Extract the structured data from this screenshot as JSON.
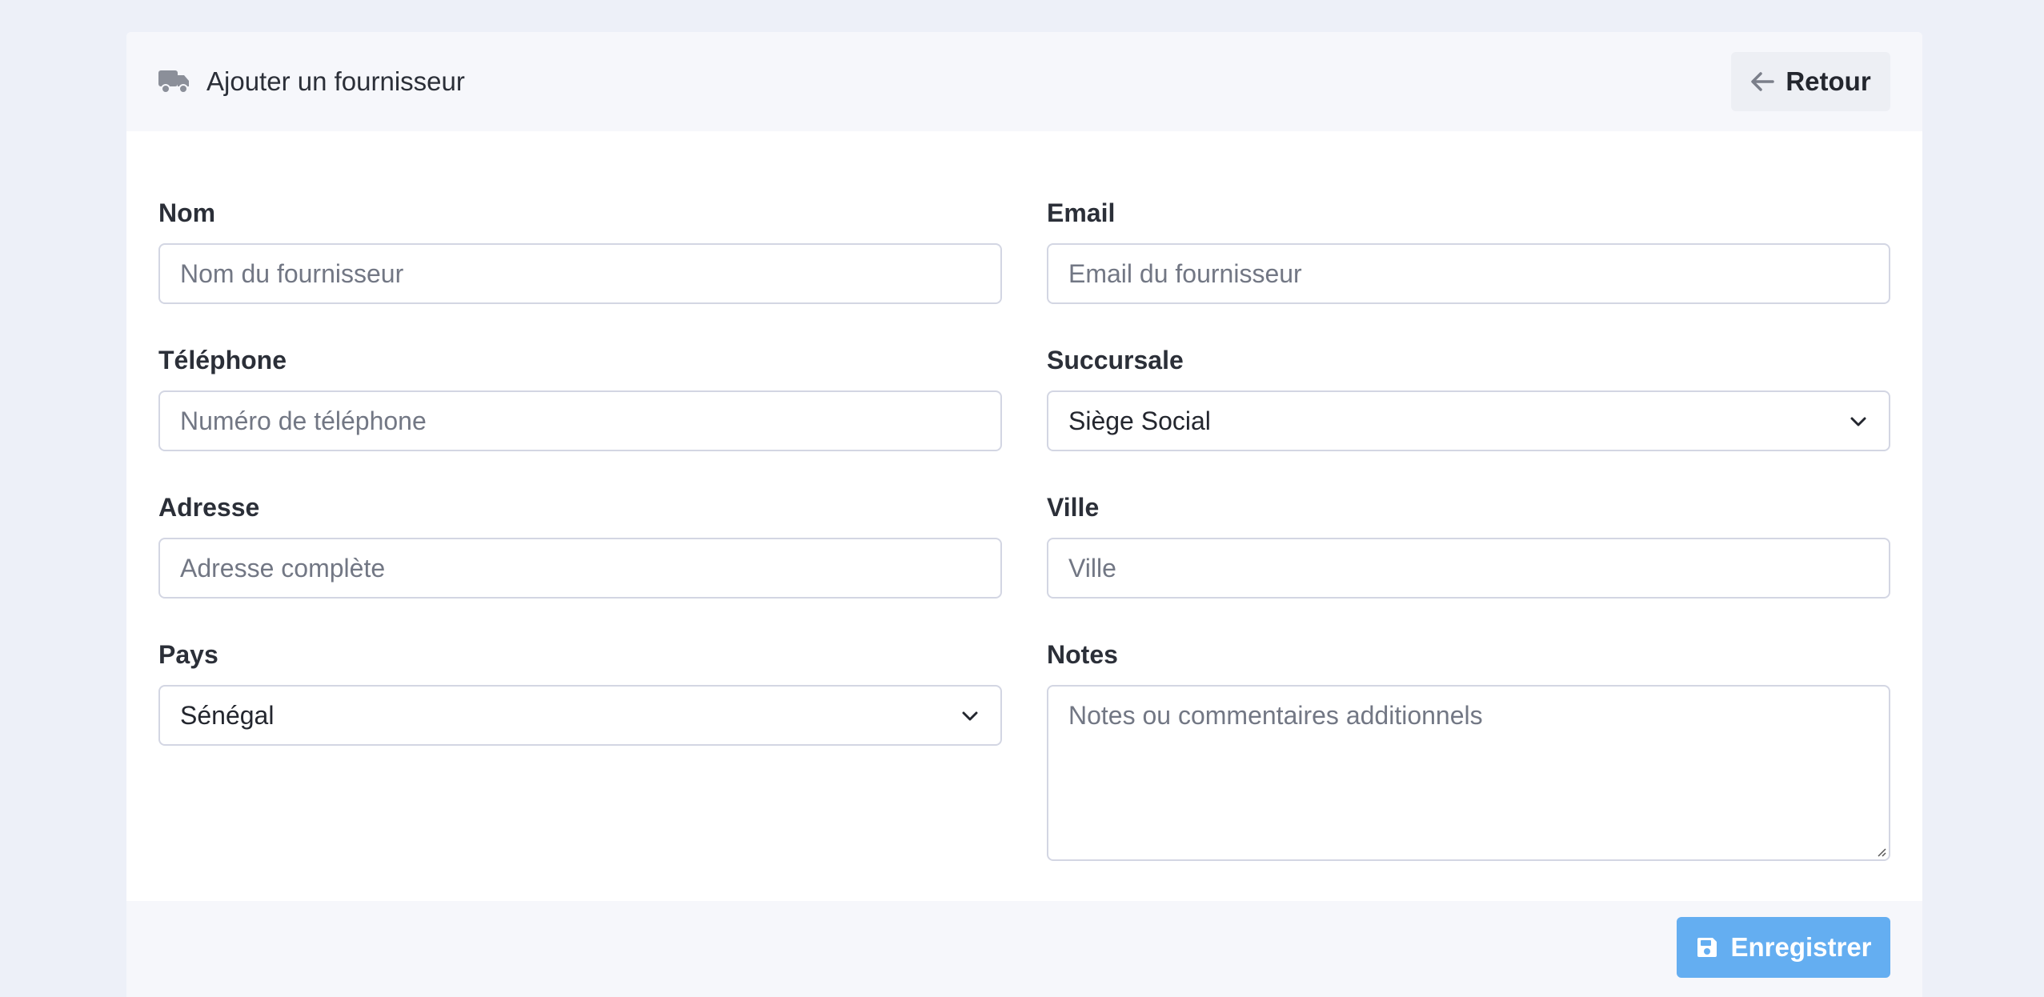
{
  "header": {
    "title": "Ajouter un fournisseur",
    "title_icon": "truck-icon",
    "back_label": "Retour",
    "back_icon": "arrow-left-icon"
  },
  "form": {
    "nom": {
      "label": "Nom",
      "placeholder": "Nom du fournisseur",
      "value": ""
    },
    "email": {
      "label": "Email",
      "placeholder": "Email du fournisseur",
      "value": ""
    },
    "telephone": {
      "label": "Téléphone",
      "placeholder": "Numéro de téléphone",
      "value": ""
    },
    "succursale": {
      "label": "Succursale",
      "selected": "Siège Social"
    },
    "adresse": {
      "label": "Adresse",
      "placeholder": "Adresse complète",
      "value": ""
    },
    "ville": {
      "label": "Ville",
      "placeholder": "Ville",
      "value": ""
    },
    "pays": {
      "label": "Pays",
      "selected": "Sénégal"
    },
    "notes": {
      "label": "Notes",
      "placeholder": "Notes ou commentaires additionnels",
      "value": ""
    }
  },
  "footer": {
    "save_label": "Enregistrer",
    "save_icon": "save-icon"
  },
  "colors": {
    "page_bg": "#edf0f8",
    "header_bg": "#f6f7fb",
    "primary": "#64aef1",
    "border": "#d3d6e3"
  }
}
